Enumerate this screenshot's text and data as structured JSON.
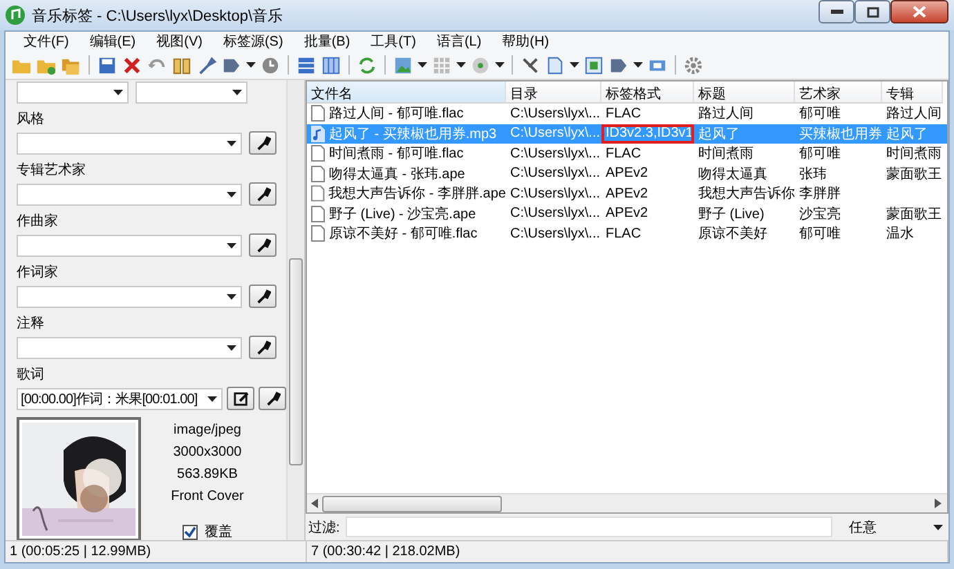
{
  "window": {
    "title": "音乐标签 - C:\\Users\\lyx\\Desktop\\音乐"
  },
  "menu": [
    "文件(F)",
    "编辑(E)",
    "视图(V)",
    "标签源(S)",
    "批量(B)",
    "工具(T)",
    "语言(L)",
    "帮助(H)"
  ],
  "tag_panel": {
    "fields": [
      {
        "label": "风格",
        "kind": "combo"
      },
      {
        "label": "专辑艺术家",
        "kind": "combo"
      },
      {
        "label": "作曲家",
        "kind": "combo"
      },
      {
        "label": "作词家",
        "kind": "combo"
      },
      {
        "label": "注释",
        "kind": "combo"
      },
      {
        "label": "歌词",
        "kind": "lyrics",
        "value": "[00:00.00]作词：米果[00:01.00]"
      }
    ],
    "cover": {
      "kind": "picture",
      "info": [
        "image/jpeg",
        "3000x3000",
        "563.89KB",
        "Front Cover"
      ],
      "overwrite": {
        "label": "覆盖",
        "checked": true
      }
    }
  },
  "table": {
    "columns": [
      "文件名",
      "目录",
      "标签格式",
      "标题",
      "艺术家",
      "专辑"
    ],
    "rows": [
      {
        "kind": "file",
        "selected": false,
        "tag_outlined": false,
        "cells": [
          "路过人间 - 郁可唯.flac",
          "C:\\Users\\lyx\\...",
          "FLAC",
          "路过人间",
          "郁可唯",
          "路过人间"
        ]
      },
      {
        "kind": "audio",
        "selected": true,
        "tag_outlined": true,
        "cells": [
          "起风了 - 买辣椒也用券.mp3",
          "C:\\Users\\lyx\\...",
          "ID3v2.3,ID3v1",
          "起风了",
          "买辣椒也用券",
          "起风了"
        ]
      },
      {
        "kind": "file",
        "selected": false,
        "tag_outlined": false,
        "cells": [
          "时间煮雨 - 郁可唯.flac",
          "C:\\Users\\lyx\\...",
          "FLAC",
          "时间煮雨",
          "郁可唯",
          "时间煮雨"
        ]
      },
      {
        "kind": "file",
        "selected": false,
        "tag_outlined": false,
        "cells": [
          "吻得太逼真 - 张玮.ape",
          "C:\\Users\\lyx\\...",
          "APEv2",
          "吻得太逼真",
          "张玮",
          "蒙面歌王"
        ]
      },
      {
        "kind": "file",
        "selected": false,
        "tag_outlined": false,
        "cells": [
          "我想大声告诉你 - 李胖胖.ape",
          "C:\\Users\\lyx\\...",
          "APEv2",
          "我想大声告诉你",
          "李胖胖",
          ""
        ]
      },
      {
        "kind": "file",
        "selected": false,
        "tag_outlined": false,
        "cells": [
          "野子 (Live) - 沙宝亮.ape",
          "C:\\Users\\lyx\\...",
          "APEv2",
          "野子 (Live)",
          "沙宝亮",
          "蒙面歌王"
        ]
      },
      {
        "kind": "file",
        "selected": false,
        "tag_outlined": false,
        "cells": [
          "原谅不美好 - 郁可唯.flac",
          "C:\\Users\\lyx\\...",
          "FLAC",
          "原谅不美好",
          "郁可唯",
          "温水"
        ]
      }
    ]
  },
  "filter": {
    "label": "过滤:",
    "mode": "任意"
  },
  "status_bar": [
    "1 (00:05:25 | 12.99MB)",
    "7 (00:30:42 | 218.02MB)"
  ]
}
